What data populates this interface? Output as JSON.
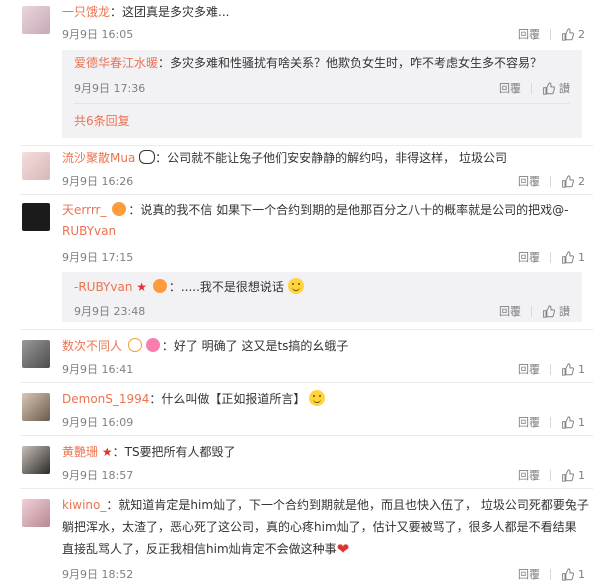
{
  "colors": {
    "username": "#eb7350",
    "meta": "#808080",
    "sub_bg": "#f2f2f5"
  },
  "comments": [
    {
      "user": "一只饿龙",
      "text": "：这团真是多灾多难...",
      "time": "9月9日 16:05",
      "reply": "回覆",
      "likes": "2"
    },
    {
      "user": "流沙聚散Mua",
      "text": "：公司就不能让兔子他们安安静静的解约吗，非得这样， 垃圾公司",
      "time": "9月9日 16:26",
      "reply": "回覆",
      "likes": "2"
    },
    {
      "user": "天errrr_",
      "text_line1": "：说真的我不信 如果下一个合约到期的是他那百分之八十的概率就是公司的把戏@-",
      "text_line2": "RUBYvan",
      "time": "9月9日 17:15",
      "reply": "回覆",
      "likes": "1"
    },
    {
      "user": "数次不同人",
      "text": "：好了 明确了 这又是ts搞的幺蛾子",
      "time": "9月9日 16:41",
      "reply": "回覆",
      "likes": "1"
    },
    {
      "user": "DemonS_1994",
      "text": "：什么叫做【正如报道所言】",
      "time": "9月9日 16:09",
      "reply": "回覆",
      "likes": "1"
    },
    {
      "user": "黄艷珊",
      "text": "：TS要把所有人都毁了",
      "time": "9月9日 18:57",
      "reply": "回覆",
      "likes": "1"
    },
    {
      "user": "kiwino_",
      "text_line1": "：就知道肯定是him灿了，下一个合约到期就是他，而且也快入伍了， 垃圾公司死都要兔子",
      "text_line2": "躺把浑水，太渣了，恶心死了这公司，真的心疼him灿了，估计又要被骂了，很多人都是不看结果",
      "text_line3": "直接乱骂人了，反正我相信him灿肯定不会做这种事",
      "time": "9月9日 18:52",
      "reply": "回覆",
      "likes": "1"
    }
  ],
  "subreplies": [
    {
      "user": "爱德华春江水暖",
      "text": "：多灾多难和性骚扰有啥关系？他欺负女生时，咋不考虑女生多不容易？",
      "time": "9月9日 17:36",
      "reply": "回覆",
      "likes": "讃"
    },
    {
      "user": "-RUBYvan",
      "text": "：.....我不是很想说话",
      "time": "9月9日 23:48",
      "reply": "回覆",
      "likes": "讃"
    }
  ],
  "more_replies": "共6条回复"
}
